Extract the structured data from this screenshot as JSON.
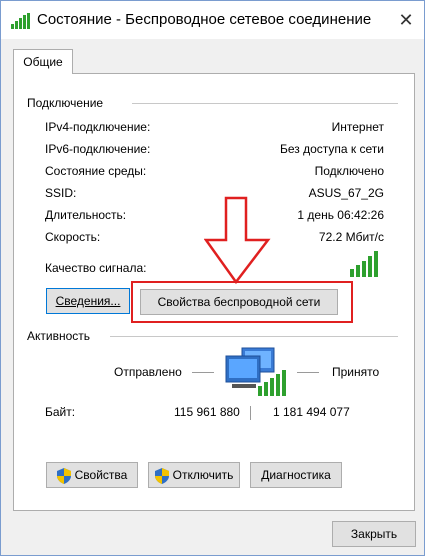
{
  "window": {
    "title": "Состояние - Беспроводное сетевое соединение",
    "close_glyph": "✕"
  },
  "tabs": [
    {
      "label": "Общие"
    }
  ],
  "connection": {
    "section_title": "Подключение",
    "rows": [
      {
        "label": "IPv4-подключение:",
        "value": "Интернет"
      },
      {
        "label": "IPv6-подключение:",
        "value": "Без доступа к сети"
      },
      {
        "label": "Состояние среды:",
        "value": "Подключено"
      },
      {
        "label": "SSID:",
        "value": "ASUS_67_2G"
      },
      {
        "label": "Длительность:",
        "value": "1 день 06:42:26"
      },
      {
        "label": "Скорость:",
        "value": "72.2 Мбит/с"
      }
    ],
    "signal_label": "Качество сигнала:",
    "signal_bars": 5,
    "details_button": "Сведения...",
    "wireless_props_button": "Свойства беспроводной сети"
  },
  "activity": {
    "section_title": "Активность",
    "sent_label": "Отправлено",
    "received_label": "Принято",
    "bytes_label": "Байт:",
    "bytes_sent": "115 961 880",
    "bytes_received": "1 181 494 077"
  },
  "actions": {
    "properties_button": "Свойства",
    "disable_button": "Отключить",
    "diagnose_button": "Диагностика"
  },
  "footer": {
    "close_button": "Закрыть"
  },
  "colors": {
    "signal_green": "#2ea02e",
    "highlight_red": "#e02020",
    "focus_blue": "#0078d7"
  }
}
